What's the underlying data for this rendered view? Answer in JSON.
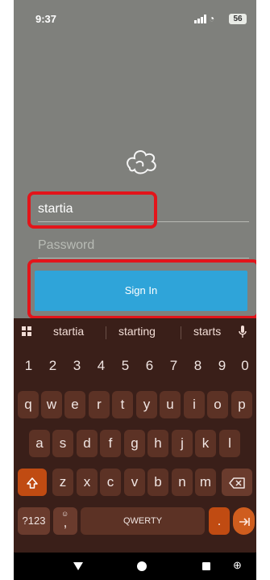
{
  "status_bar": {
    "time": "9:37",
    "battery": "56"
  },
  "login": {
    "username_value": "startia",
    "password_placeholder": "Password",
    "sign_in_label": "Sign In"
  },
  "keyboard": {
    "suggestions": [
      "startia",
      "starting",
      "starts"
    ],
    "row_numbers": [
      "1",
      "2",
      "3",
      "4",
      "5",
      "6",
      "7",
      "8",
      "9",
      "0"
    ],
    "row1": [
      "q",
      "w",
      "e",
      "r",
      "t",
      "y",
      "u",
      "i",
      "o",
      "p"
    ],
    "row2": [
      "a",
      "s",
      "d",
      "f",
      "g",
      "h",
      "j",
      "k",
      "l"
    ],
    "row3": [
      "z",
      "x",
      "c",
      "v",
      "b",
      "n",
      "m"
    ],
    "symbols_label": "?123",
    "emoji_comma": ",",
    "space_label": "QWERTY",
    "period_label": "."
  },
  "colors": {
    "background": "#7f807c",
    "sign_in_button": "#2fa4d9",
    "highlight": "#e3141a",
    "keyboard": "#3a1f19",
    "key": "#5c3225",
    "accent_key": "#c04b12"
  }
}
